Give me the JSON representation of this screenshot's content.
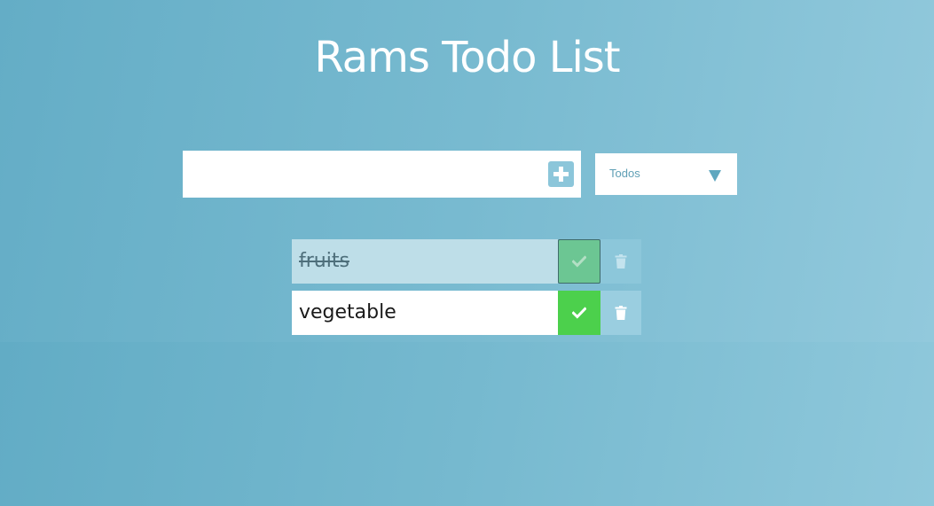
{
  "app": {
    "title": "Rams Todo List"
  },
  "input": {
    "value": "",
    "placeholder": ""
  },
  "add_button": {
    "icon": "plus-square-icon"
  },
  "filter": {
    "selected": "Todos",
    "icon": "caret-down-icon"
  },
  "todos": [
    {
      "text": "fruits",
      "completed": true
    },
    {
      "text": "vegetable",
      "completed": false
    }
  ],
  "colors": {
    "background_start": "#64adc6",
    "background_end": "#92c9dc",
    "check": "#4cd04c",
    "check_completed": "#6cc693",
    "trash": "#9acee0",
    "completed_item_bg": "#bedee8"
  }
}
